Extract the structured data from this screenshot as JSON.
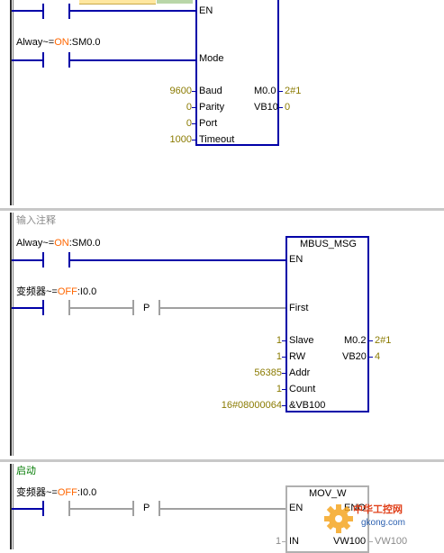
{
  "network1": {
    "en_label": "EN",
    "contact_always": {
      "prefix": "Alway~=",
      "state": "ON",
      "suffix": ":SM0.0"
    },
    "mode_label": "Mode",
    "inputs": [
      {
        "value": "9600",
        "label": "Baud"
      },
      {
        "value": "0",
        "label": "Parity"
      },
      {
        "value": "0",
        "label": "Port"
      },
      {
        "value": "1000",
        "label": "Timeout"
      }
    ],
    "outputs": [
      {
        "label": "M0.0",
        "value": "2#1"
      },
      {
        "label": "VB10",
        "value": "0"
      }
    ]
  },
  "network2": {
    "comment": "输入注释",
    "block_title": "MBUS_MSG",
    "contact_always": {
      "prefix": "Alway~=",
      "state": "ON",
      "suffix": ":SM0.0"
    },
    "contact_vfd": {
      "prefix": "变频器~=",
      "state": "OFF",
      "suffix": ":I0.0"
    },
    "p_label": "P",
    "en_label": "EN",
    "first_label": "First",
    "inputs": [
      {
        "value": "1",
        "label": "Slave"
      },
      {
        "value": "1",
        "label": "RW"
      },
      {
        "value": "56385",
        "label": "Addr"
      },
      {
        "value": "1",
        "label": "Count"
      },
      {
        "value": "16#08000064",
        "label": "&VB100"
      }
    ],
    "outputs": [
      {
        "label": "M0.2",
        "value": "2#1"
      },
      {
        "label": "VB20",
        "value": "4"
      }
    ]
  },
  "network3": {
    "comment": "启动",
    "block_title": "MOV_W",
    "contact_vfd": {
      "prefix": "变频器~=",
      "state": "OFF",
      "suffix": ":I0.0"
    },
    "p_label": "P",
    "en_label": "EN",
    "eno_label": "ENO",
    "in": {
      "value": "1",
      "label": "IN"
    },
    "out": {
      "label": "VW100",
      "value": "VW100"
    }
  },
  "watermark": {
    "cn": "中华工控网",
    "url": "gkong.com"
  },
  "colors": {
    "wire": "#0000a8",
    "value": "#8a7a00",
    "on": "#ff6600",
    "comment": "#007a00"
  }
}
